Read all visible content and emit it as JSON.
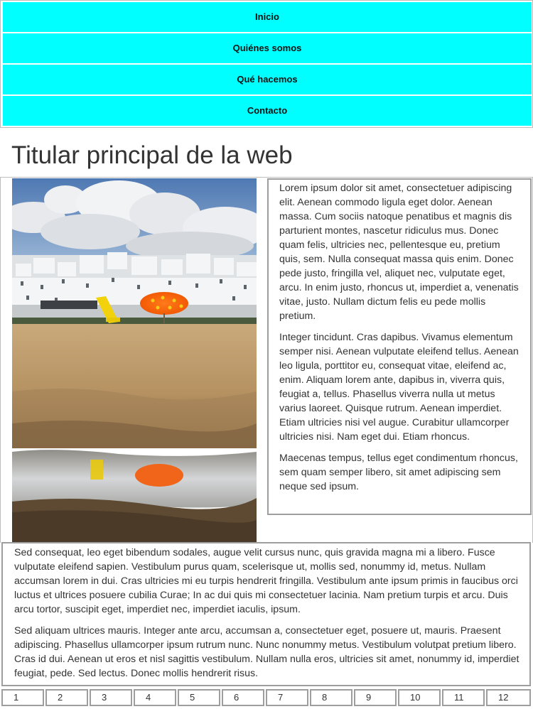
{
  "nav": {
    "items": [
      {
        "label": "Inicio"
      },
      {
        "label": "Quiénes somos"
      },
      {
        "label": "Qué hacemos"
      },
      {
        "label": "Contacto"
      }
    ]
  },
  "page": {
    "title": "Titular principal de la web"
  },
  "aside": {
    "paragraphs": [
      "Lorem ipsum dolor sit amet, consectetuer adipiscing elit. Aenean commodo ligula eget dolor. Aenean massa. Cum sociis natoque penatibus et magnis dis parturient montes, nascetur ridiculus mus. Donec quam felis, ultricies nec, pellentesque eu, pretium quis, sem. Nulla consequat massa quis enim. Donec pede justo, fringilla vel, aliquet nec, vulputate eget, arcu. In enim justo, rhoncus ut, imperdiet a, venenatis vitae, justo. Nullam dictum felis eu pede mollis pretium.",
      "Integer tincidunt. Cras dapibus. Vivamus elementum semper nisi. Aenean vulputate eleifend tellus. Aenean leo ligula, porttitor eu, consequat vitae, eleifend ac, enim. Aliquam lorem ante, dapibus in, viverra quis, feugiat a, tellus. Phasellus viverra nulla ut metus varius laoreet. Quisque rutrum. Aenean imperdiet. Etiam ultricies nisi vel augue. Curabitur ullamcorper ultricies nisi. Nam eget dui. Etiam rhoncus.",
      "Maecenas tempus, tellus eget condimentum rhoncus, sem quam semper libero, sit amet adipiscing sem neque sed ipsum."
    ]
  },
  "main": {
    "paragraphs": [
      "Sed consequat, leo eget bibendum sodales, augue velit cursus nunc, quis gravida magna mi a libero. Fusce vulputate eleifend sapien. Vestibulum purus quam, scelerisque ut, mollis sed, nonummy id, metus. Nullam accumsan lorem in dui. Cras ultricies mi eu turpis hendrerit fringilla. Vestibulum ante ipsum primis in faucibus orci luctus et ultrices posuere cubilia Curae; In ac dui quis mi consectetuer lacinia. Nam pretium turpis et arcu. Duis arcu tortor, suscipit eget, imperdiet nec, imperdiet iaculis, ipsum.",
      "Sed aliquam ultrices mauris. Integer ante arcu, accumsan a, consectetuer eget, posuere ut, mauris. Praesent adipiscing. Phasellus ullamcorper ipsum rutrum nunc. Nunc nonummy metus. Vestibulum volutpat pretium libero. Cras id dui. Aenean ut eros et nisl sagittis vestibulum. Nullam nulla eros, ultricies sit amet, nonummy id, imperdiet feugiat, pede. Sed lectus. Donec mollis hendrerit risus."
    ]
  },
  "pagination": {
    "pages": [
      "1",
      "2",
      "3",
      "4",
      "5",
      "6",
      "7",
      "8",
      "9",
      "10",
      "11",
      "12"
    ]
  },
  "colors": {
    "nav_background": "#00ffff",
    "border": "#9e9e9e",
    "text": "#333333"
  },
  "image": {
    "icon": "beach-photo"
  }
}
